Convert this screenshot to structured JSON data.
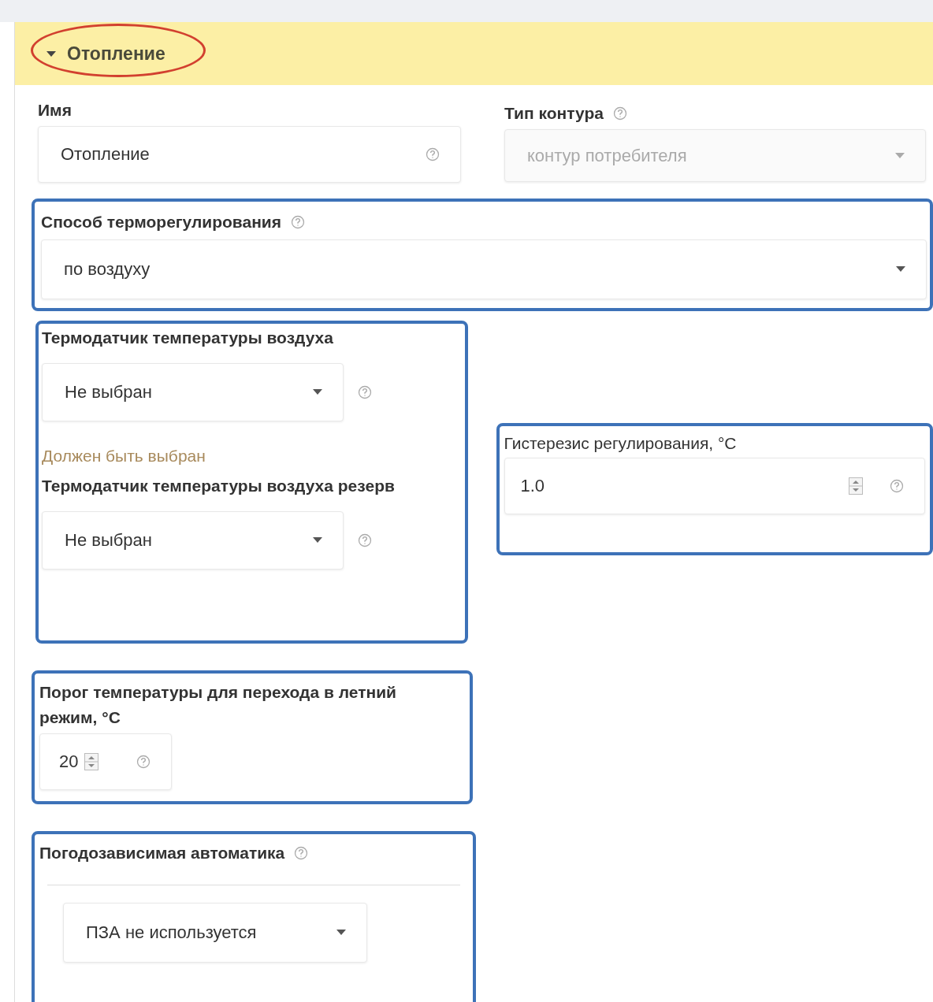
{
  "header": {
    "title": "Отопление",
    "expanded": true,
    "circled": true
  },
  "name_field": {
    "label": "Имя",
    "value": "Отопление"
  },
  "circuit_type": {
    "label": "Тип контура",
    "value": "контур потребителя",
    "disabled": true
  },
  "regulation_method": {
    "label": "Способ терморегулирования",
    "value": "по воздуху",
    "highlighted": true
  },
  "air_sensors": {
    "highlighted": true,
    "sensors": [
      {
        "label": "Термодатчик температуры воздуха",
        "value": "Не выбран",
        "error": "Должен быть выбран"
      },
      {
        "label": "Термодатчик температуры воздуха резерв",
        "value": "Не выбран"
      }
    ]
  },
  "hysteresis": {
    "label": "Гистерезис регулирования, °C",
    "value": "1.0",
    "highlighted": true
  },
  "summer_threshold": {
    "label": "Порог температуры для перехода в летний режим, °C",
    "value": "20",
    "highlighted": true
  },
  "weather_automation": {
    "label": "Погодозависимая автоматика",
    "value": "ПЗА не используется",
    "highlighted": true
  }
}
